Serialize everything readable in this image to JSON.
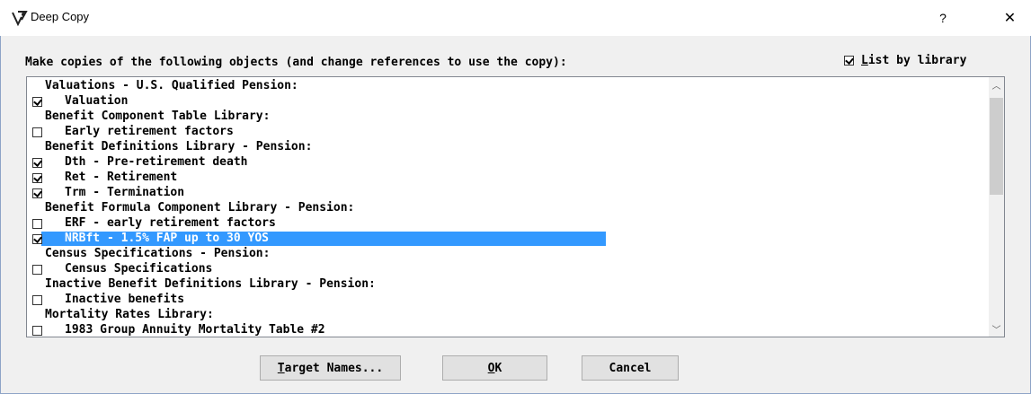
{
  "window": {
    "title": "Deep Copy",
    "help_label": "?",
    "close_label": "✕"
  },
  "instruction": "Make copies of the following objects (and change references to use the copy):",
  "list_by_library": {
    "label_prefix": "L",
    "label_rest": "ist by library",
    "checked": true
  },
  "list": [
    {
      "kind": "header",
      "text": "Valuations - U.S. Qualified Pension:"
    },
    {
      "kind": "item",
      "text": "Valuation",
      "checked": true
    },
    {
      "kind": "header",
      "text": "Benefit Component Table Library:"
    },
    {
      "kind": "item",
      "text": "Early retirement factors",
      "checked": false
    },
    {
      "kind": "header",
      "text": "Benefit Definitions Library - Pension:"
    },
    {
      "kind": "item",
      "text": "Dth - Pre-retirement death",
      "checked": true
    },
    {
      "kind": "item",
      "text": "Ret - Retirement",
      "checked": true
    },
    {
      "kind": "item",
      "text": "Trm - Termination",
      "checked": true
    },
    {
      "kind": "header",
      "text": "Benefit Formula Component Library - Pension:"
    },
    {
      "kind": "item",
      "text": "ERF - early retirement factors",
      "checked": false
    },
    {
      "kind": "item",
      "text": "NRBft - 1.5% FAP up to 30 YOS",
      "checked": true,
      "selected": true
    },
    {
      "kind": "header",
      "text": "Census Specifications - Pension:"
    },
    {
      "kind": "item",
      "text": "Census Specifications",
      "checked": false
    },
    {
      "kind": "header",
      "text": "Inactive Benefit Definitions Library - Pension:"
    },
    {
      "kind": "item",
      "text": "Inactive benefits",
      "checked": false
    },
    {
      "kind": "header",
      "text": "Mortality Rates Library:"
    },
    {
      "kind": "item",
      "text": "1983 Group Annuity Mortality Table #2",
      "checked": false
    }
  ],
  "scrollbar": {
    "up_icon": "chevron-up-icon",
    "down_icon": "chevron-down-icon"
  },
  "buttons": {
    "target_prefix": "T",
    "target_rest": "arget Names...",
    "ok_prefix": "O",
    "ok_rest": "K",
    "cancel": "Cancel"
  }
}
